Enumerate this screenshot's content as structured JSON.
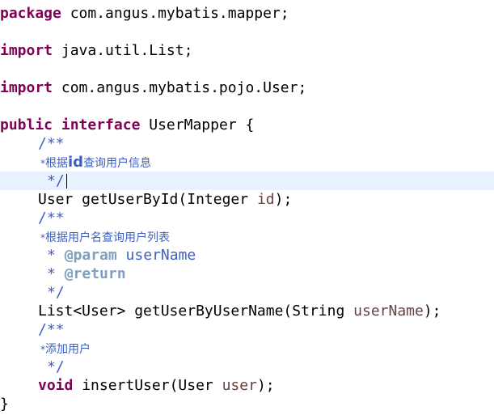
{
  "code": {
    "kw_package": "package",
    "package_name": " com.angus.mybatis.mapper;",
    "kw_import1": "import",
    "import1": " java.util.List;",
    "kw_import2": "import",
    "import2": " com.angus.mybatis.pojo.User;",
    "kw_public": "public",
    "kw_interface": "interface",
    "interface_name": " UserMapper {",
    "doc_open": "/**",
    "doc_close": "*/",
    "doc_star": "*",
    "m1_comment_a": "根据",
    "m1_comment_id": "id",
    "m1_comment_b": "查询用户信息",
    "m1_return_type": "User getUserById(Integer ",
    "m1_param": "id",
    "m1_end": ");",
    "m2_comment": "根据用户名查询用户列表",
    "m2_tag_param": "@param",
    "m2_tag_param_name": " userName",
    "m2_tag_return": "@return",
    "m2_signature": "List<User> getUserByUserName(String ",
    "m2_param": "userName",
    "m2_end": ");",
    "m3_comment": "添加用户",
    "kw_void": "void",
    "m3_signature": " insertUser(User ",
    "m3_param": "user",
    "m3_end": ");",
    "close_brace": "}"
  },
  "colors": {
    "keyword": "#7f0055",
    "javadoc": "#3f5fbf",
    "javadoc_tag": "#7f9fbf",
    "parameter": "#6a3e3e",
    "current_line": "#e8f2fe"
  }
}
